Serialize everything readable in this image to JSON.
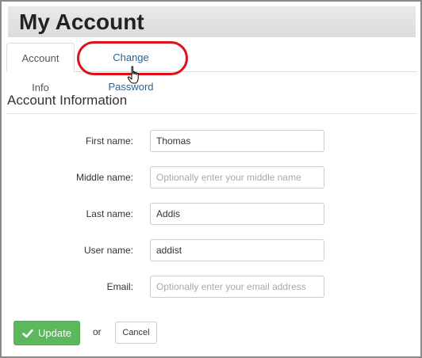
{
  "page": {
    "title": "My Account"
  },
  "tabs": [
    {
      "label": "Account Info",
      "active": true
    },
    {
      "label": "Change Password",
      "active": false,
      "highlighted": true
    }
  ],
  "section": {
    "title": "Account Information"
  },
  "form": {
    "first_name": {
      "label": "First name:",
      "value": "Thomas",
      "placeholder": ""
    },
    "middle_name": {
      "label": "Middle name:",
      "value": "",
      "placeholder": "Optionally enter your middle name"
    },
    "last_name": {
      "label": "Last name:",
      "value": "Addis",
      "placeholder": ""
    },
    "user_name": {
      "label": "User name:",
      "value": "addist",
      "placeholder": ""
    },
    "email": {
      "label": "Email:",
      "value": "",
      "placeholder": "Optionally enter your email address"
    }
  },
  "actions": {
    "update_label": "Update",
    "update_icon": "checkmark-icon",
    "or_text": "or",
    "cancel_label": "Cancel"
  },
  "colors": {
    "update_button": "#5cb85c",
    "highlight_ring": "#e0101a",
    "link": "#2a6496"
  }
}
